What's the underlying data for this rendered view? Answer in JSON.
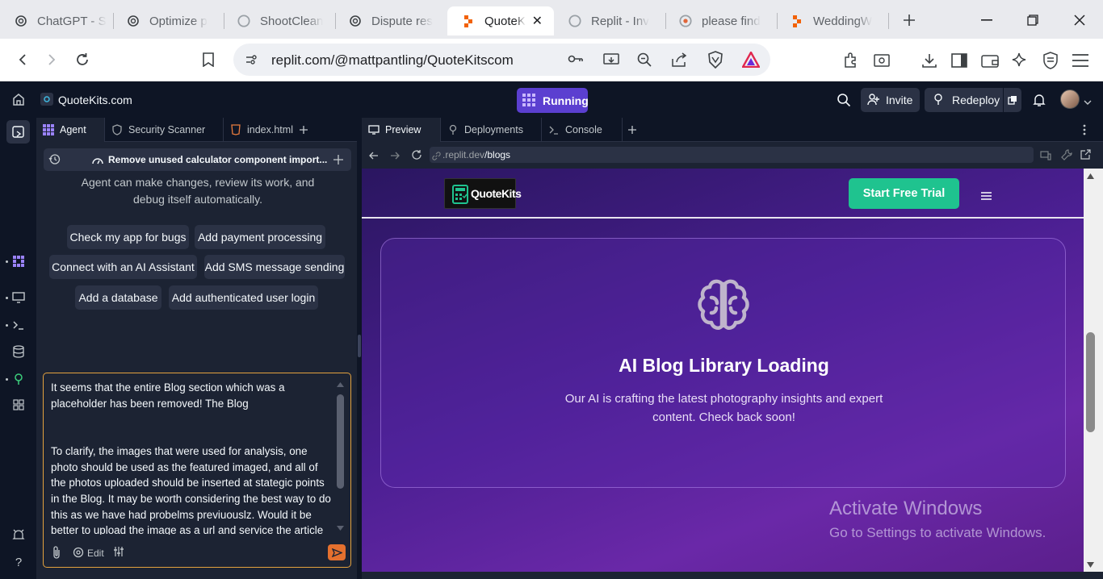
{
  "browser": {
    "tabs": [
      {
        "title": "ChatGPT - S",
        "icon": "openai-icon"
      },
      {
        "title": "Optimize p",
        "icon": "openai-icon"
      },
      {
        "title": "ShootClean",
        "icon": "loading-icon"
      },
      {
        "title": "Dispute res",
        "icon": "openai-icon"
      },
      {
        "title": "QuoteK",
        "icon": "replit-icon",
        "active": true
      },
      {
        "title": "Replit - Inv",
        "icon": "loading-icon"
      },
      {
        "title": "please find",
        "icon": "brave-icon"
      },
      {
        "title": "WeddingW",
        "icon": "replit-icon"
      }
    ],
    "address": "replit.com/@mattpantling/QuoteKitscom"
  },
  "replit": {
    "project_name": "QuoteKits.com",
    "run_status": "Running",
    "invite_label": "Invite",
    "redeploy_label": "Redeploy"
  },
  "left_panel": {
    "tabs": [
      "Agent",
      "Security Scanner",
      "index.html"
    ],
    "history_title": "Remove unused calculator component import...",
    "agent_description": "Agent can make changes, review its work, and debug itself automatically.",
    "suggestions": [
      "Check my app for bugs",
      "Add payment processing",
      "Connect with an AI Assistant",
      "Add SMS message sending",
      "Add a database",
      "Add authenticated user login"
    ],
    "message": "It seems that the entire Blog section which was a placeholder has been removed! The Blog\n\n\nTo clarify, the images that were used for analysis, one photo should be used as the featured imaged, and all of the photos uploaded should be inserted at stategic points in the Blog. It may be worth considering the best way to do this as we have had probelms previuouslz. Would it be better to upload the image as a url and service the article",
    "edit_label": "Edit"
  },
  "right_panel": {
    "tabs": [
      "Preview",
      "Deployments",
      "Console"
    ],
    "url_prefix": ".replit.dev",
    "url_path": "/blogs"
  },
  "site": {
    "logo_text": "QuoteKits",
    "cta_label": "Start Free Trial",
    "card_title": "AI Blog Library Loading",
    "card_description": "Our AI is crafting the latest photography insights and expert content. Check back soon!"
  },
  "watermark": {
    "line1": "Activate Windows",
    "line2": "Go to Settings to activate Windows."
  },
  "colors": {
    "run_button": "#5b3fd0",
    "cta_green": "#1fc38f",
    "send_orange": "#e4702e",
    "input_border": "#e4a23e"
  }
}
